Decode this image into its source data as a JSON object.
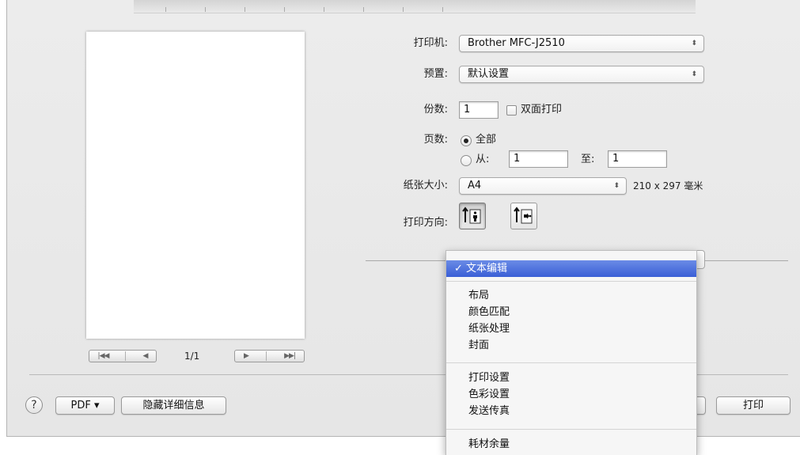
{
  "settings": {
    "printer_label": "打印机:",
    "printer_value": "Brother MFC-J2510",
    "preset_label": "预置:",
    "preset_value": "默认设置",
    "copies_label": "份数:",
    "copies_value": "1",
    "duplex_label": "双面打印",
    "pages_label": "页数:",
    "pages_all": "全部",
    "pages_from": "从:",
    "pages_from_value": "1",
    "pages_to": "至:",
    "pages_to_value": "1",
    "paper_label": "纸张大小:",
    "paper_value": "A4",
    "paper_dims": "210 x 297 毫米",
    "orientation_label": "打印方向:"
  },
  "preview": {
    "page_count": "1/1",
    "first_page_glyph": "|◀◀",
    "prev_page_glyph": "◀",
    "next_page_glyph": "▶",
    "last_page_glyph": "▶▶|"
  },
  "menu": {
    "selected": "✓ 文本编辑",
    "group1": [
      "布局",
      "颜色匹配",
      "纸张处理",
      "封面"
    ],
    "group2": [
      "打印设置",
      "色彩设置",
      "发送传真"
    ],
    "group3": [
      "耗材余量"
    ]
  },
  "footer": {
    "help": "?",
    "pdf_label": "PDF ▾",
    "hide_details": "隐藏详细信息",
    "print": "打印"
  },
  "icons": {
    "popup_arrows": "⬍",
    "orientation_portrait": "portrait-orientation-icon",
    "orientation_landscape": "landscape-orientation-icon"
  }
}
